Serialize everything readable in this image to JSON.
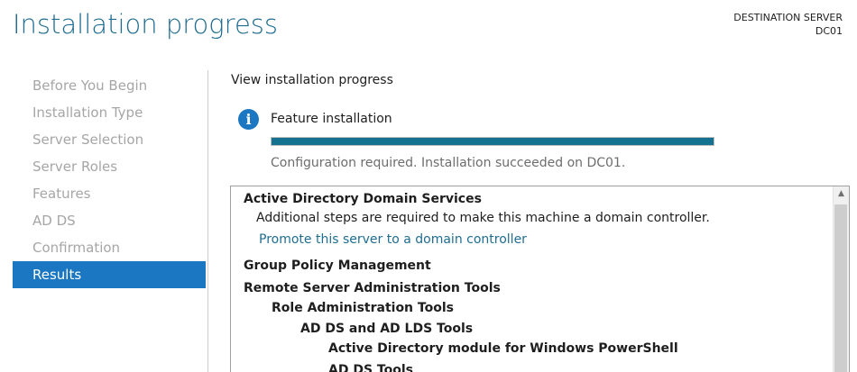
{
  "header": {
    "title": "Installation progress",
    "destination_label": "DESTINATION SERVER",
    "destination_server": "DC01"
  },
  "sidebar": {
    "items": [
      {
        "label": "Before You Begin",
        "active": false
      },
      {
        "label": "Installation Type",
        "active": false
      },
      {
        "label": "Server Selection",
        "active": false
      },
      {
        "label": "Server Roles",
        "active": false
      },
      {
        "label": "Features",
        "active": false
      },
      {
        "label": "AD DS",
        "active": false
      },
      {
        "label": "Confirmation",
        "active": false
      },
      {
        "label": "Results",
        "active": true
      }
    ]
  },
  "main": {
    "heading": "View installation progress",
    "feature_label": "Feature installation",
    "progress_percent": 100,
    "status_text": "Configuration required. Installation succeeded on DC01.",
    "results": [
      {
        "text": "Active Directory Domain Services",
        "style": "bold",
        "level": 0
      },
      {
        "text": "Additional steps are required to make this machine a domain controller.",
        "style": "normal",
        "level": 1
      },
      {
        "text": "Promote this server to a domain controller",
        "style": "link",
        "level": 1
      },
      {
        "text": "Group Policy Management",
        "style": "bold",
        "level": 0
      },
      {
        "text": "Remote Server Administration Tools",
        "style": "bold",
        "level": 0
      },
      {
        "text": "Role Administration Tools",
        "style": "bold",
        "level": 1
      },
      {
        "text": "AD DS and AD LDS Tools",
        "style": "bold",
        "level": 2
      },
      {
        "text": "Active Directory module for Windows PowerShell",
        "style": "bold",
        "level": 3
      },
      {
        "text": "AD DS Tools",
        "style": "bold",
        "level": 3
      }
    ]
  },
  "colors": {
    "accent": "#1b77c1",
    "title": "#1f6d91",
    "progress": "#137290"
  },
  "icons": {
    "feature_status": "info-icon",
    "scroll_up": "chevron-up-icon"
  }
}
